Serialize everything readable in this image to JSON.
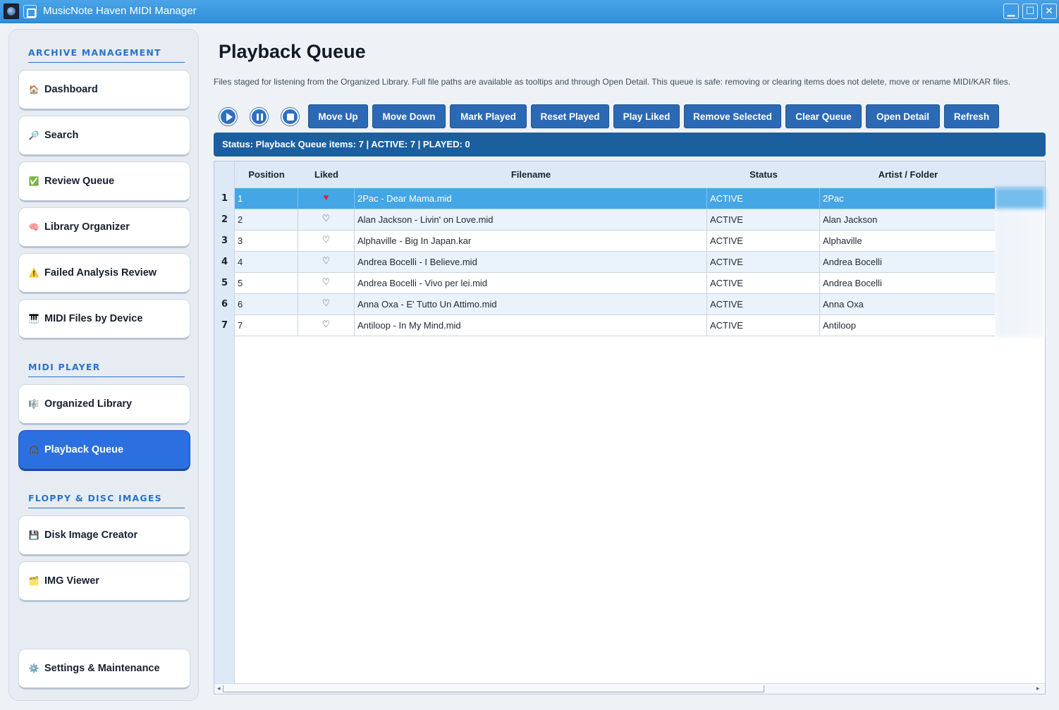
{
  "window": {
    "title": "MusicNote Haven MIDI Manager",
    "controls": [
      "minimize",
      "maximize",
      "close"
    ]
  },
  "sidebar": {
    "sections": [
      {
        "label": "ARCHIVE MANAGEMENT"
      },
      {
        "label": "MIDI PLAYER"
      },
      {
        "label": "FLOPPY & DISC IMAGES"
      }
    ],
    "items": [
      {
        "label": "Dashboard",
        "icon": "🏠"
      },
      {
        "label": "Search",
        "icon": "🔎"
      },
      {
        "label": "Review Queue",
        "icon": "✅"
      },
      {
        "label": "Library Organizer",
        "icon": "🧠"
      },
      {
        "label": "Failed Analysis Review",
        "icon": "⚠️"
      },
      {
        "label": "MIDI Files by Device",
        "icon": "🎹"
      },
      {
        "label": "Organized Library",
        "icon": "🎼"
      },
      {
        "label": "Playback Queue",
        "icon": "🎧",
        "active": true
      },
      {
        "label": "Disk Image Creator",
        "icon": "💾"
      },
      {
        "label": "IMG Viewer",
        "icon": "🗂️"
      },
      {
        "label": "Settings & Maintenance",
        "icon": "⚙️"
      }
    ]
  },
  "main": {
    "title": "Playback Queue",
    "description": "Files staged for listening from the Organized Library. Full file paths are available as tooltips and through Open Detail. This queue is safe: removing or clearing items does not delete, move or rename MIDI/KAR files.",
    "toolbar": {
      "icons": [
        "play-icon",
        "pause-icon",
        "stop-icon"
      ],
      "buttons": [
        "Move Up",
        "Move Down",
        "Mark Played",
        "Reset Played",
        "Play Liked",
        "Remove Selected",
        "Clear Queue",
        "Open Detail",
        "Refresh"
      ]
    },
    "status": "Status: Playback Queue items: 7 | ACTIVE: 7 | PLAYED: 0",
    "table": {
      "columns": [
        "Position",
        "Liked",
        "Filename",
        "Status",
        "Artist / Folder"
      ],
      "rows": [
        {
          "num": "1",
          "position": "1",
          "liked": "♥",
          "filename": "2Pac - Dear Mama.mid",
          "status": "ACTIVE",
          "artist": "2Pac"
        },
        {
          "num": "2",
          "position": "2",
          "liked": "♡",
          "filename": "Alan Jackson - Livin' on Love.mid",
          "status": "ACTIVE",
          "artist": "Alan Jackson"
        },
        {
          "num": "3",
          "position": "3",
          "liked": "♡",
          "filename": "Alphaville - Big In Japan.kar",
          "status": "ACTIVE",
          "artist": "Alphaville"
        },
        {
          "num": "4",
          "position": "4",
          "liked": "♡",
          "filename": "Andrea Bocelli - I Believe.mid",
          "status": "ACTIVE",
          "artist": "Andrea Bocelli"
        },
        {
          "num": "5",
          "position": "5",
          "liked": "♡",
          "filename": "Andrea Bocelli - Vivo per lei.mid",
          "status": "ACTIVE",
          "artist": "Andrea Bocelli"
        },
        {
          "num": "6",
          "position": "6",
          "liked": "♡",
          "filename": "Anna Oxa - E' Tutto Un Attimo.mid",
          "status": "ACTIVE",
          "artist": "Anna Oxa"
        },
        {
          "num": "7",
          "position": "7",
          "liked": "♡",
          "filename": "Antiloop - In My Mind.mid",
          "status": "ACTIVE",
          "artist": "Antiloop"
        }
      ]
    }
  },
  "colors": {
    "accent": "#2c6fe0",
    "toolbar_button": "#2c69b4",
    "status_bar": "#1b5f9f",
    "selected_row": "#45a6e5",
    "liked_heart": "#e0222c"
  }
}
